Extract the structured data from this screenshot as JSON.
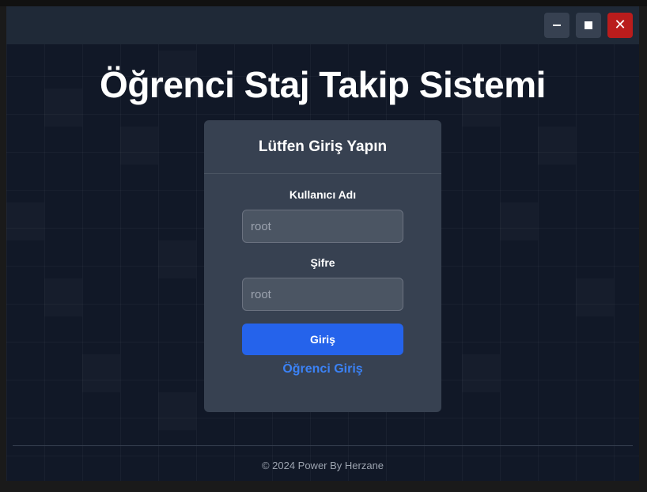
{
  "window": {
    "controls": {
      "minimize_icon": "minimize-icon",
      "maximize_icon": "maximize-icon",
      "close_icon": "close-icon",
      "close_glyph": "✕",
      "close_color": "#b91c1c"
    }
  },
  "page": {
    "title": "Öğrenci Staj Takip Sistemi"
  },
  "login": {
    "heading": "Lütfen Giriş Yapın",
    "username_label": "Kullanıcı Adı",
    "username_placeholder": "root",
    "password_label": "Şifre",
    "password_placeholder": "root",
    "submit_label": "Giriş",
    "student_link": "Öğrenci Giriş",
    "accent": "#2563eb"
  },
  "footer": {
    "text": "© 2024 Power By Herzane"
  }
}
